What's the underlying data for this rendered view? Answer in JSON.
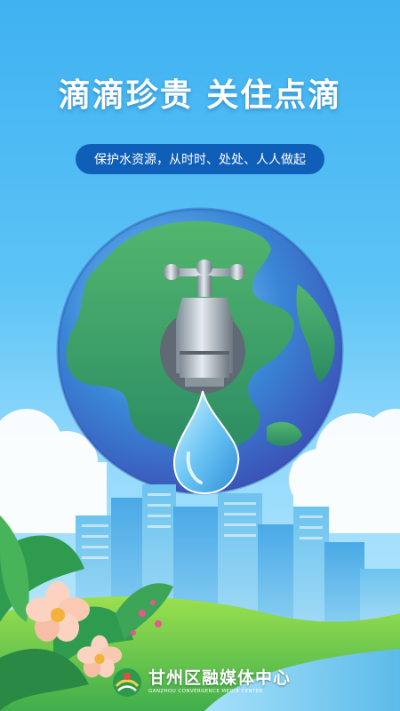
{
  "poster": {
    "title": "滴滴珍贵  关住点滴",
    "subtitle": "保护水资源，从时时、处处、人人做起"
  },
  "logo": {
    "name": "甘州区融媒体中心",
    "english": "GANZHOU CONVERGENCE MEDIA CENTER"
  },
  "colors": {
    "sky": "#3fb2f2",
    "pill": "#0f5fb8",
    "ocean": "#3a86d6",
    "land": "#3fa66b",
    "water_drop": "#7fd0f7"
  },
  "icons": [
    "earth-globe",
    "water-faucet",
    "water-drop",
    "flower",
    "city-skyline"
  ]
}
